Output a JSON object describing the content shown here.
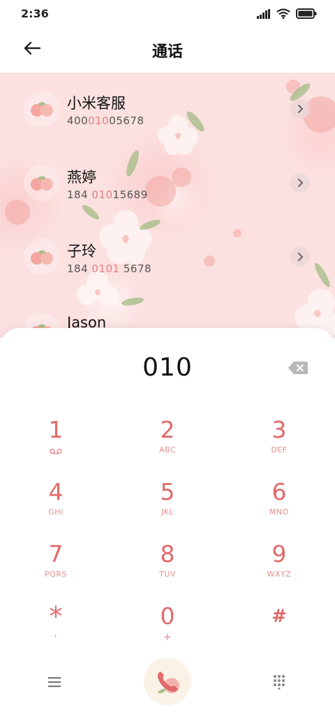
{
  "status_bar": {
    "time": "2:36",
    "icons": [
      "signal-icon",
      "wifi-icon",
      "battery-icon"
    ]
  },
  "header": {
    "title": "通话",
    "back_icon": "back-arrow-icon"
  },
  "contacts": [
    {
      "name": "小米客服",
      "number_parts": [
        "400",
        "010",
        "05678"
      ]
    },
    {
      "name": "燕婷",
      "number_parts": [
        "184 ",
        "010",
        "15689"
      ]
    },
    {
      "name": "子玲",
      "number_parts": [
        "184 ",
        "0101",
        " 5678"
      ]
    },
    {
      "name": "Jason",
      "number_parts": [
        "",
        "",
        ""
      ]
    }
  ],
  "dialpad": {
    "display": "010",
    "keys": [
      {
        "digit": "1",
        "letters": "",
        "icon": "voicemail-icon"
      },
      {
        "digit": "2",
        "letters": "ABC"
      },
      {
        "digit": "3",
        "letters": "DEF"
      },
      {
        "digit": "4",
        "letters": "GHI"
      },
      {
        "digit": "5",
        "letters": "JKL"
      },
      {
        "digit": "6",
        "letters": "MNO"
      },
      {
        "digit": "7",
        "letters": "PQRS"
      },
      {
        "digit": "8",
        "letters": "TUV"
      },
      {
        "digit": "9",
        "letters": "WXYZ"
      },
      {
        "digit": "*",
        "letters": ","
      },
      {
        "digit": "0",
        "letters": "+"
      },
      {
        "digit": "#",
        "letters": ""
      }
    ]
  },
  "colors": {
    "accent": "#e06a6a",
    "accent_light": "#e88d8d",
    "highlight": "#e3807f",
    "list_background": "#fbe1e0"
  }
}
